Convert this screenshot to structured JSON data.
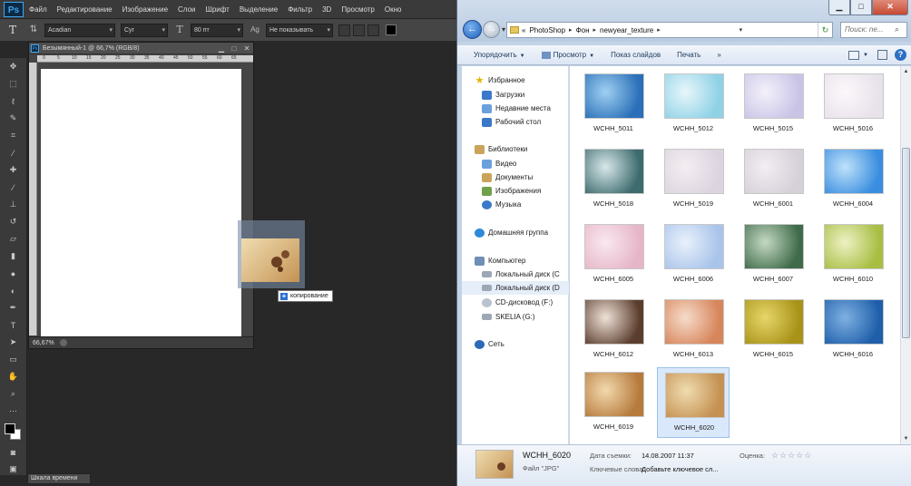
{
  "photoshop": {
    "logo": "Ps",
    "menu": [
      "Файл",
      "Редактирование",
      "Изображение",
      "Слои",
      "Шрифт",
      "Выделение",
      "Фильтр",
      "3D",
      "Просмотр",
      "Окно"
    ],
    "options": {
      "font_family": "Acadian",
      "font_style": "Cyr",
      "font_size": "80 пт",
      "aa_label": "Ag",
      "antialias": "Не показывать"
    },
    "document": {
      "tab_title": "Безымянный-1 @ 66,7% (RGB/8)",
      "zoom": "66,67%",
      "ruler_ticks": [
        "0",
        "5",
        "10",
        "15",
        "20",
        "25",
        "30",
        "35",
        "40",
        "45",
        "50",
        "55",
        "60",
        "65"
      ]
    },
    "drag_tooltip": "копирование",
    "timeline_tab": "Шкала времени",
    "colors": {
      "fg": "#000000",
      "bg": "#ffffff"
    }
  },
  "explorer": {
    "breadcrumb": [
      "PhotoShop",
      "Фон",
      "newyear_texture"
    ],
    "breadcrumb_prefix": "«",
    "search_placeholder": "Поиск: ne...",
    "commands": [
      "Упорядочить",
      "Просмотр",
      "Показ слайдов",
      "Печать",
      "»"
    ],
    "nav": {
      "favorites": "Избранное",
      "favorites_items": [
        "Загрузки",
        "Недавние места",
        "Рабочий стол"
      ],
      "libraries": "Библиотеки",
      "libraries_items": [
        "Видео",
        "Документы",
        "Изображения",
        "Музыка"
      ],
      "homegroup": "Домашняя группа",
      "computer": "Компьютер",
      "computer_items": [
        "Локальный диск (C",
        "Локальный диск (D",
        "CD-дисковод (F:)",
        "SKELIA (G:)"
      ],
      "network": "Сеть"
    },
    "files": [
      {
        "name": "WCHH_5011",
        "c1": "#2a6fb8",
        "c2": "#9fd0f2"
      },
      {
        "name": "WCHH_5012",
        "c1": "#8fd2e6",
        "c2": "#e8f6fb"
      },
      {
        "name": "WCHH_5015",
        "c1": "#c9c4e6",
        "c2": "#f4f1fb"
      },
      {
        "name": "WCHH_5016",
        "c1": "#e8e2ea",
        "c2": "#fbf8fb"
      },
      {
        "name": "WCHH_5018",
        "c1": "#3d6b6e",
        "c2": "#d8e8ea"
      },
      {
        "name": "WCHH_5019",
        "c1": "#dcd4df",
        "c2": "#f4eef2"
      },
      {
        "name": "WCHH_6001",
        "c1": "#d6d0d8",
        "c2": "#f2eef3"
      },
      {
        "name": "WCHH_6004",
        "c1": "#3a8ee0",
        "c2": "#bfe2fa"
      },
      {
        "name": "WCHH_6005",
        "c1": "#e6b6c8",
        "c2": "#f9e8ef"
      },
      {
        "name": "WCHH_6006",
        "c1": "#a9c4ea",
        "c2": "#e9f1fb"
      },
      {
        "name": "WCHH_6007",
        "c1": "#3f6b4a",
        "c2": "#c4d9c2"
      },
      {
        "name": "WCHH_6010",
        "c1": "#a7be43",
        "c2": "#eef1c4"
      },
      {
        "name": "WCHH_6012",
        "c1": "#5b3d2d",
        "c2": "#f0e2d8"
      },
      {
        "name": "WCHH_6013",
        "c1": "#d7855a",
        "c2": "#f6dccb"
      },
      {
        "name": "WCHH_6015",
        "c1": "#a89318",
        "c2": "#e7d66a"
      },
      {
        "name": "WCHH_6016",
        "c1": "#1f5faa",
        "c2": "#7fb1e2"
      },
      {
        "name": "WCHH_6019",
        "c1": "#b67a3c",
        "c2": "#f2d9ad"
      },
      {
        "name": "WCHH_6020",
        "c1": "#c49152",
        "c2": "#f0dcb0"
      }
    ],
    "selected_file": "WCHH_6020",
    "details": {
      "name": "WCHH_6020",
      "type": "Файл \"JPG\"",
      "date_label": "Дата съемки:",
      "date_value": "14.08.2007 11:37",
      "keywords_label": "Ключевые слова:",
      "keywords_value": "Добавьте ключевое сл...",
      "rating_label": "Оценка:",
      "rating_stars": "☆☆☆☆☆"
    }
  }
}
